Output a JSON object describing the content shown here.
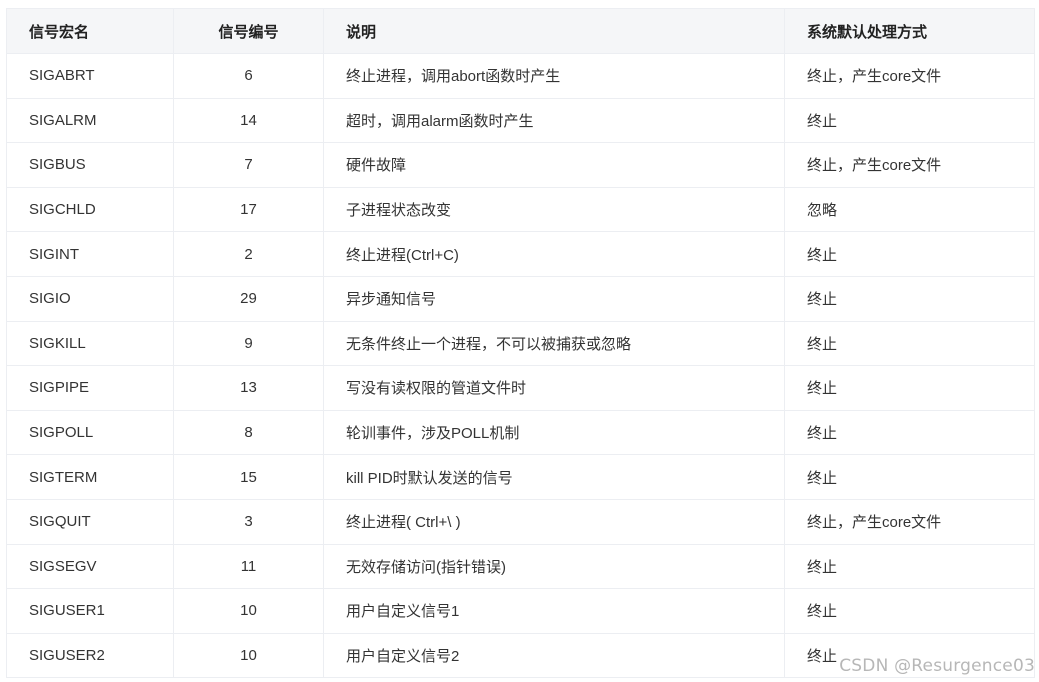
{
  "table": {
    "headers": [
      "信号宏名",
      "信号编号",
      "说明",
      "系统默认处理方式"
    ],
    "rows": [
      [
        "SIGABRT",
        "6",
        "终止进程，调用abort函数时产生",
        "终止，产生core文件"
      ],
      [
        "SIGALRM",
        "14",
        "超时，调用alarm函数时产生",
        "终止"
      ],
      [
        "SIGBUS",
        "7",
        "硬件故障",
        "终止，产生core文件"
      ],
      [
        "SIGCHLD",
        "17",
        "子进程状态改变",
        "忽略"
      ],
      [
        "SIGINT",
        "2",
        "终止进程(Ctrl+C)",
        "终止"
      ],
      [
        "SIGIO",
        "29",
        "异步通知信号",
        "终止"
      ],
      [
        "SIGKILL",
        "9",
        "无条件终止一个进程，不可以被捕获或忽略",
        "终止"
      ],
      [
        "SIGPIPE",
        "13",
        "写没有读权限的管道文件时",
        "终止"
      ],
      [
        "SIGPOLL",
        "8",
        "轮训事件，涉及POLL机制",
        "终止"
      ],
      [
        "SIGTERM",
        "15",
        "kill PID时默认发送的信号",
        "终止"
      ],
      [
        "SIGQUIT",
        "3",
        "终止进程( Ctrl+\\ )",
        "终止，产生core文件"
      ],
      [
        "SIGSEGV",
        "11",
        "无效存储访问(指针错误)",
        "终止"
      ],
      [
        "SIGUSER1",
        "10",
        "用户自定义信号1",
        "终止"
      ],
      [
        "SIGUSER2",
        "10",
        "用户自定义信号2",
        "终止"
      ]
    ]
  },
  "watermark": "CSDN @Resurgence03"
}
